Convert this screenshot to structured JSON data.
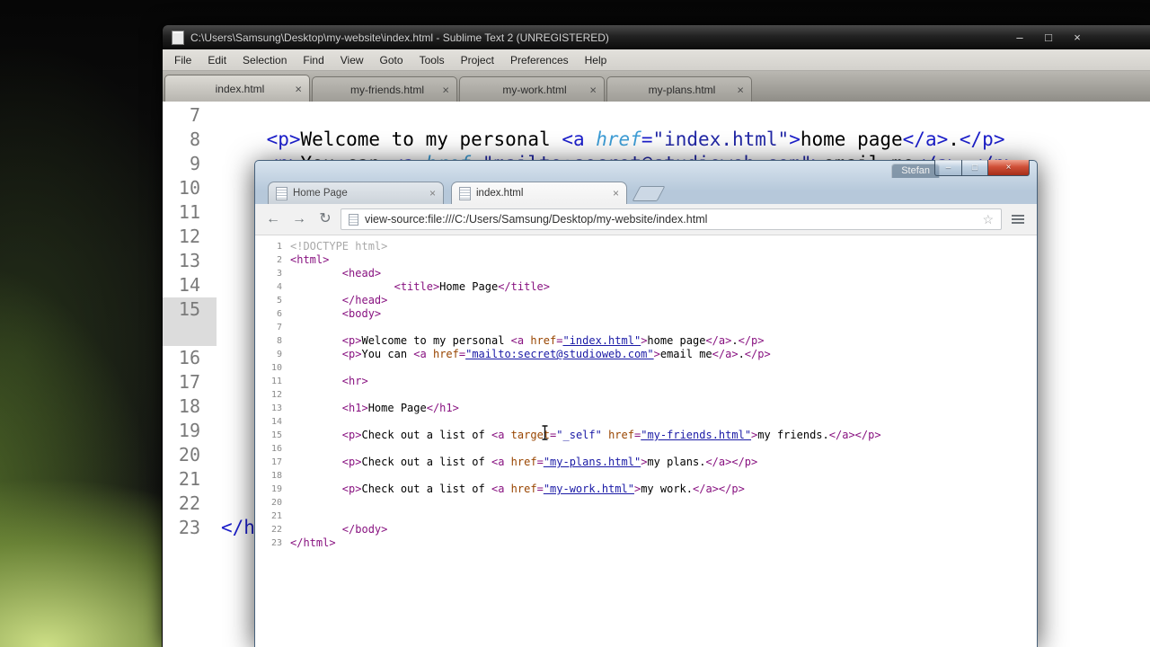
{
  "colors": {
    "vs-tag": "#881280",
    "vs-attr": "#994500",
    "vs-val": "#1a1aa6",
    "vs-link": "#1a1aa6",
    "vs-doctype": "#a9a9a9",
    "vs-text": "#000000",
    "vs-linenum": "#8a8a8a",
    "st-tag": "#1b1ecb",
    "st-attr": "#3d9dd6",
    "st-str": "#2228a6",
    "st-text": "#000000",
    "chrome-close-red": "#d05038"
  },
  "sublime": {
    "window_title": "C:\\Users\\Samsung\\Desktop\\my-website\\index.html - Sublime Text 2 (UNREGISTERED)",
    "window_controls": {
      "minimize": "–",
      "maximize": "□",
      "close": "×"
    },
    "tab_close_glyph": "×",
    "menu_items": [
      "File",
      "Edit",
      "Selection",
      "Find",
      "View",
      "Goto",
      "Tools",
      "Project",
      "Preferences",
      "Help"
    ],
    "tabs": [
      {
        "label": "index.html",
        "active": true
      },
      {
        "label": "my-friends.html",
        "active": false
      },
      {
        "label": "my-work.html",
        "active": false
      },
      {
        "label": "my-plans.html",
        "active": false
      }
    ],
    "gutter": [
      {
        "n": "7"
      },
      {
        "n": "8"
      },
      {
        "n": "9"
      },
      {
        "n": "10"
      },
      {
        "n": "11"
      },
      {
        "n": "12"
      },
      {
        "n": "13"
      },
      {
        "n": "14"
      },
      {
        "n": "15",
        "hl": true
      },
      {
        "n": "",
        "hl": true
      },
      {
        "n": "16"
      },
      {
        "n": "17"
      },
      {
        "n": "18"
      },
      {
        "n": "19"
      },
      {
        "n": "20"
      },
      {
        "n": "21"
      },
      {
        "n": "22"
      },
      {
        "n": "23"
      }
    ],
    "code_lines": [
      {
        "row": 1,
        "tokens": [
          [
            "tx",
            "    "
          ],
          [
            "stag",
            "<p>"
          ],
          [
            "tx",
            "Welcome to my personal "
          ],
          [
            "stag",
            "<a "
          ],
          [
            "sattr",
            "href"
          ],
          [
            "stag",
            "="
          ],
          [
            "sstr",
            "\"index.html\""
          ],
          [
            "stag",
            ">"
          ],
          [
            "tx",
            "home page"
          ],
          [
            "stag",
            "</a>"
          ],
          [
            "tx",
            "."
          ],
          [
            "stag",
            "</p>"
          ]
        ]
      },
      {
        "row": 2,
        "tokens": [
          [
            "tx",
            "    "
          ],
          [
            "stag",
            "<p>"
          ],
          [
            "tx",
            "You can "
          ],
          [
            "stag",
            "<a "
          ],
          [
            "sattr",
            "href"
          ],
          [
            "stag",
            "="
          ],
          [
            "sstr",
            "\"mailto:secret@studioweb.com\""
          ],
          [
            "stag",
            ">"
          ],
          [
            "tx",
            "email me"
          ],
          [
            "stag",
            "</a>"
          ],
          [
            "tx",
            "."
          ],
          [
            "stag",
            "</p>"
          ]
        ]
      },
      {
        "row": 17,
        "tokens": [
          [
            "stag",
            "</html>"
          ]
        ]
      }
    ]
  },
  "chrome": {
    "profile_badge": "Stefan",
    "window_controls": {
      "minimize": "–",
      "maximize": "□",
      "close": "×"
    },
    "tab_close_glyph": "×",
    "tabs": [
      {
        "label": "Home Page",
        "active": false
      },
      {
        "label": "index.html",
        "active": true
      }
    ],
    "nav": {
      "back": "←",
      "forward": "→",
      "reload": "↻",
      "bookmark_star": "☆"
    },
    "address": "view-source:file:///C:/Users/Samsung/Desktop/my-website/index.html",
    "source_lines": [
      {
        "n": 1,
        "tokens": [
          [
            "c",
            "<!DOCTYPE html>"
          ]
        ]
      },
      {
        "n": 2,
        "tokens": [
          [
            "t",
            "<html>"
          ]
        ]
      },
      {
        "n": 3,
        "tokens": [
          [
            "tx",
            "        "
          ],
          [
            "t",
            "<head>"
          ]
        ]
      },
      {
        "n": 4,
        "tokens": [
          [
            "tx",
            "                "
          ],
          [
            "t",
            "<title>"
          ],
          [
            "tx",
            "Home Page"
          ],
          [
            "t",
            "</title>"
          ]
        ]
      },
      {
        "n": 5,
        "tokens": [
          [
            "tx",
            "        "
          ],
          [
            "t",
            "</head>"
          ]
        ]
      },
      {
        "n": 6,
        "tokens": [
          [
            "tx",
            "        "
          ],
          [
            "t",
            "<body>"
          ]
        ]
      },
      {
        "n": 7,
        "tokens": []
      },
      {
        "n": 8,
        "tokens": [
          [
            "tx",
            "        "
          ],
          [
            "t",
            "<p>"
          ],
          [
            "tx",
            "Welcome to my personal "
          ],
          [
            "t",
            "<a "
          ],
          [
            "an",
            "href"
          ],
          [
            "t",
            "="
          ],
          [
            "lk",
            "\"index.html\""
          ],
          [
            "t",
            ">"
          ],
          [
            "tx",
            "home page"
          ],
          [
            "t",
            "</a>"
          ],
          [
            "tx",
            "."
          ],
          [
            "t",
            "</p>"
          ]
        ]
      },
      {
        "n": 9,
        "tokens": [
          [
            "tx",
            "        "
          ],
          [
            "t",
            "<p>"
          ],
          [
            "tx",
            "You can "
          ],
          [
            "t",
            "<a "
          ],
          [
            "an",
            "href"
          ],
          [
            "t",
            "="
          ],
          [
            "lk",
            "\"mailto:secret@studioweb.com\""
          ],
          [
            "t",
            ">"
          ],
          [
            "tx",
            "email me"
          ],
          [
            "t",
            "</a>"
          ],
          [
            "tx",
            "."
          ],
          [
            "t",
            "</p>"
          ]
        ]
      },
      {
        "n": 10,
        "tokens": []
      },
      {
        "n": 11,
        "tokens": [
          [
            "tx",
            "        "
          ],
          [
            "t",
            "<hr>"
          ]
        ]
      },
      {
        "n": 12,
        "tokens": []
      },
      {
        "n": 13,
        "tokens": [
          [
            "tx",
            "        "
          ],
          [
            "t",
            "<h1>"
          ],
          [
            "tx",
            "Home Page"
          ],
          [
            "t",
            "</h1>"
          ]
        ]
      },
      {
        "n": 14,
        "tokens": []
      },
      {
        "n": 15,
        "tokens": [
          [
            "tx",
            "        "
          ],
          [
            "t",
            "<p>"
          ],
          [
            "tx",
            "Check out a list of "
          ],
          [
            "t",
            "<a "
          ],
          [
            "an",
            "target"
          ],
          [
            "t",
            "="
          ],
          [
            "av",
            "\"_self\""
          ],
          [
            "tx",
            " "
          ],
          [
            "an",
            "href"
          ],
          [
            "t",
            "="
          ],
          [
            "lk",
            "\"my-friends.html\""
          ],
          [
            "t",
            ">"
          ],
          [
            "tx",
            "my friends."
          ],
          [
            "t",
            "</a>"
          ],
          [
            "t",
            "</p>"
          ]
        ]
      },
      {
        "n": 16,
        "tokens": []
      },
      {
        "n": 17,
        "tokens": [
          [
            "tx",
            "        "
          ],
          [
            "t",
            "<p>"
          ],
          [
            "tx",
            "Check out a list of "
          ],
          [
            "t",
            "<a "
          ],
          [
            "an",
            "href"
          ],
          [
            "t",
            "="
          ],
          [
            "lk",
            "\"my-plans.html\""
          ],
          [
            "t",
            ">"
          ],
          [
            "tx",
            "my plans."
          ],
          [
            "t",
            "</a>"
          ],
          [
            "t",
            "</p>"
          ]
        ]
      },
      {
        "n": 18,
        "tokens": []
      },
      {
        "n": 19,
        "tokens": [
          [
            "tx",
            "        "
          ],
          [
            "t",
            "<p>"
          ],
          [
            "tx",
            "Check out a list of "
          ],
          [
            "t",
            "<a "
          ],
          [
            "an",
            "href"
          ],
          [
            "t",
            "="
          ],
          [
            "lk",
            "\"my-work.html\""
          ],
          [
            "t",
            ">"
          ],
          [
            "tx",
            "my work."
          ],
          [
            "t",
            "</a>"
          ],
          [
            "t",
            "</p>"
          ]
        ]
      },
      {
        "n": 20,
        "tokens": []
      },
      {
        "n": 21,
        "tokens": []
      },
      {
        "n": 22,
        "tokens": [
          [
            "tx",
            "        "
          ],
          [
            "t",
            "</body>"
          ]
        ]
      },
      {
        "n": 23,
        "tokens": [
          [
            "t",
            "</html>"
          ]
        ]
      }
    ]
  }
}
